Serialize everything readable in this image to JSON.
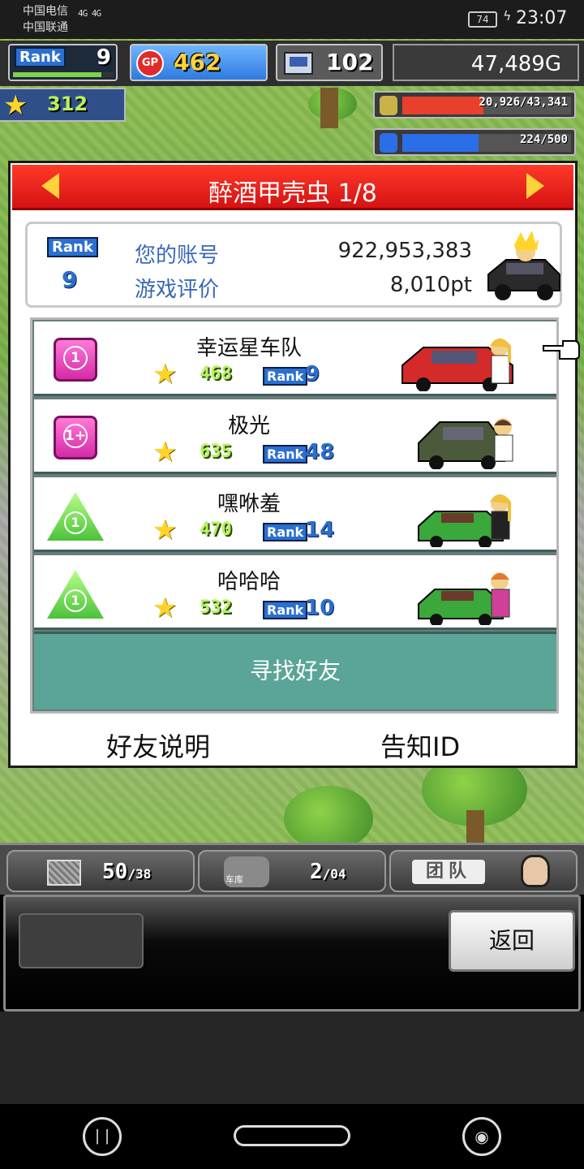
{
  "status_bar": {
    "carrier_1": "中国电信",
    "carrier_2": "中国联通",
    "network": "4G 4G",
    "battery": "74",
    "time": "23:07"
  },
  "hud": {
    "rank_label": "Rank",
    "rank_value": "9",
    "rank_progress": 0.88,
    "gp_label": "GP",
    "gp_value": "462",
    "pc_value": "102",
    "money": "47,489G",
    "stars": "312",
    "fuel_text": "20,926/43,341",
    "fuel_fill": 0.48,
    "fuel_color": "#e8402a",
    "water_text": "224/500",
    "water_fill": 0.45,
    "water_color": "#2a6fe8"
  },
  "modal": {
    "title": "醉酒甲壳虫 1/8",
    "prev_icon": "triangle-left-icon",
    "next_icon": "triangle-right-icon"
  },
  "profile": {
    "rank_label": "Rank",
    "rank_value": "9",
    "account_label": "您的账号",
    "account_value": "922,953,383",
    "rating_label": "游戏评价",
    "rating_value": "8,010pt"
  },
  "friends": [
    {
      "name": "幸运星车队",
      "badge": "1",
      "badge_shape": "square",
      "stars": "468",
      "rank_label": "Rank",
      "rank": "9",
      "car_color": "#d42a2a"
    },
    {
      "name": "极光",
      "badge": "1+",
      "badge_shape": "square",
      "stars": "635",
      "rank_label": "Rank",
      "rank": "48",
      "car_color": "#4a5a3a"
    },
    {
      "name": "嘿咻羞",
      "badge": "1",
      "badge_shape": "triangle",
      "stars": "470",
      "rank_label": "Rank",
      "rank": "14",
      "car_color": "#3aa83a"
    },
    {
      "name": "哈哈哈",
      "badge": "1",
      "badge_shape": "triangle",
      "stars": "532",
      "rank_label": "Rank",
      "rank": "10",
      "car_color": "#3aa83a"
    }
  ],
  "find_friend_label": "寻找好友",
  "footer": {
    "friend_info": "好友说明",
    "notify_id": "告知ID"
  },
  "bottom_hud": {
    "items_count": "50",
    "items_max": "/38",
    "garage_label": "车库",
    "garage_count": "2",
    "garage_max": "/04",
    "team_label": "团队"
  },
  "panel": {
    "back_label": "返回"
  }
}
